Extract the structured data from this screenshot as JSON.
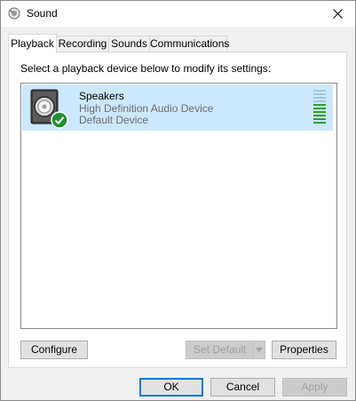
{
  "window": {
    "title": "Sound",
    "close_glyph": "✕"
  },
  "tabs": [
    {
      "label": "Playback",
      "active": true
    },
    {
      "label": "Recording",
      "active": false
    },
    {
      "label": "Sounds",
      "active": false
    },
    {
      "label": "Communications",
      "active": false
    }
  ],
  "playback": {
    "instruction": "Select a playback device below to modify its settings:",
    "devices": [
      {
        "name": "Speakers",
        "description": "High Definition Audio Device",
        "status": "Default Device",
        "icon": "speaker-icon",
        "badge_icon": "default-check-icon",
        "level": 0.55
      }
    ],
    "buttons": {
      "configure": "Configure",
      "set_default": "Set Default",
      "properties": "Properties"
    }
  },
  "footer": {
    "ok": "OK",
    "cancel": "Cancel",
    "apply": "Apply"
  },
  "colors": {
    "selection": "#cce8ff",
    "accent": "#0078d7",
    "meter_active": "#2f9e2f",
    "meter_idle": "#9ec8e0"
  }
}
